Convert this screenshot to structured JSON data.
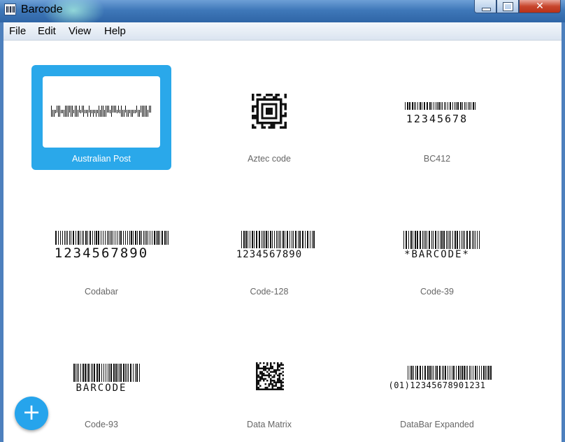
{
  "window": {
    "title": "Barcode"
  },
  "menu": [
    "File",
    "Edit",
    "View",
    "Help"
  ],
  "barcodes": [
    {
      "label": "Australian Post",
      "selected": true,
      "sample_text": ""
    },
    {
      "label": "Aztec code",
      "selected": false,
      "sample_text": ""
    },
    {
      "label": "BC412",
      "selected": false,
      "sample_text": "12345678"
    },
    {
      "label": "Codabar",
      "selected": false,
      "sample_text": "1234567890"
    },
    {
      "label": "Code-128",
      "selected": false,
      "sample_text": "1234567890"
    },
    {
      "label": "Code-39",
      "selected": false,
      "sample_text": "*BARCODE*"
    },
    {
      "label": "Code-93",
      "selected": false,
      "sample_text": "BARCODE"
    },
    {
      "label": "Data Matrix",
      "selected": false,
      "sample_text": ""
    },
    {
      "label": "DataBar Expanded",
      "selected": false,
      "sample_text": "(01)12345678901231"
    }
  ],
  "fab": {
    "icon": "plus-icon",
    "glyph": "+"
  },
  "colors": {
    "accent": "#2aa8ea",
    "fab": "#26a4ec",
    "label": "#666666"
  }
}
